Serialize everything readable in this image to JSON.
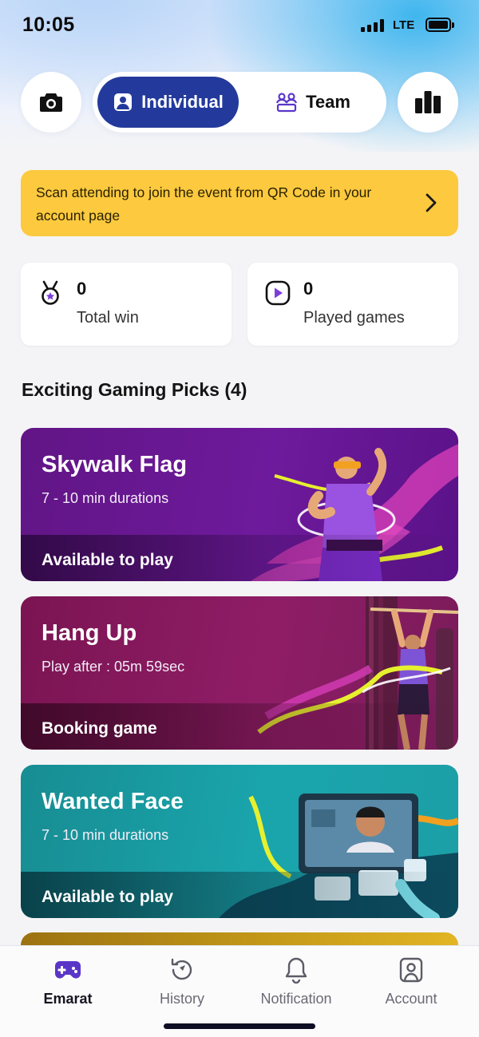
{
  "status": {
    "time": "10:05",
    "network": "LTE"
  },
  "header": {
    "camera_icon": "camera-icon",
    "tabs": [
      {
        "label": "Individual",
        "icon": "person-icon",
        "active": true
      },
      {
        "label": "Team",
        "icon": "team-icon",
        "active": false
      }
    ],
    "leaderboard_icon": "leaderboard-icon"
  },
  "banner": {
    "text": "Scan attending to join the event from QR Code in your account page",
    "icon": "chevron-right-icon"
  },
  "stats": [
    {
      "value": "0",
      "label": "Total win",
      "icon": "medal-icon"
    },
    {
      "value": "0",
      "label": "Played games",
      "icon": "play-icon"
    }
  ],
  "section": {
    "title": "Exciting Gaming Picks (4)"
  },
  "games": [
    {
      "title": "Skywalk Flag",
      "subtitle": "7 - 10 min durations",
      "status": "Available to play",
      "color": "#6a1494"
    },
    {
      "title": "Hang Up",
      "subtitle": "Play after : 05m 59sec",
      "status": "Booking game",
      "color": "#8a1c5f"
    },
    {
      "title": "Wanted Face",
      "subtitle": "7 - 10 min durations",
      "status": "Available to play",
      "color": "#1b9aa0"
    }
  ],
  "nav": [
    {
      "label": "Emarat",
      "icon": "gamepad-icon",
      "active": true
    },
    {
      "label": "History",
      "icon": "history-icon",
      "active": false
    },
    {
      "label": "Notification",
      "icon": "bell-icon",
      "active": false
    },
    {
      "label": "Account",
      "icon": "account-icon",
      "active": false
    }
  ],
  "colors": {
    "accent": "#233a9c",
    "banner": "#fcc93f",
    "nav_active": "#5a36c8"
  }
}
